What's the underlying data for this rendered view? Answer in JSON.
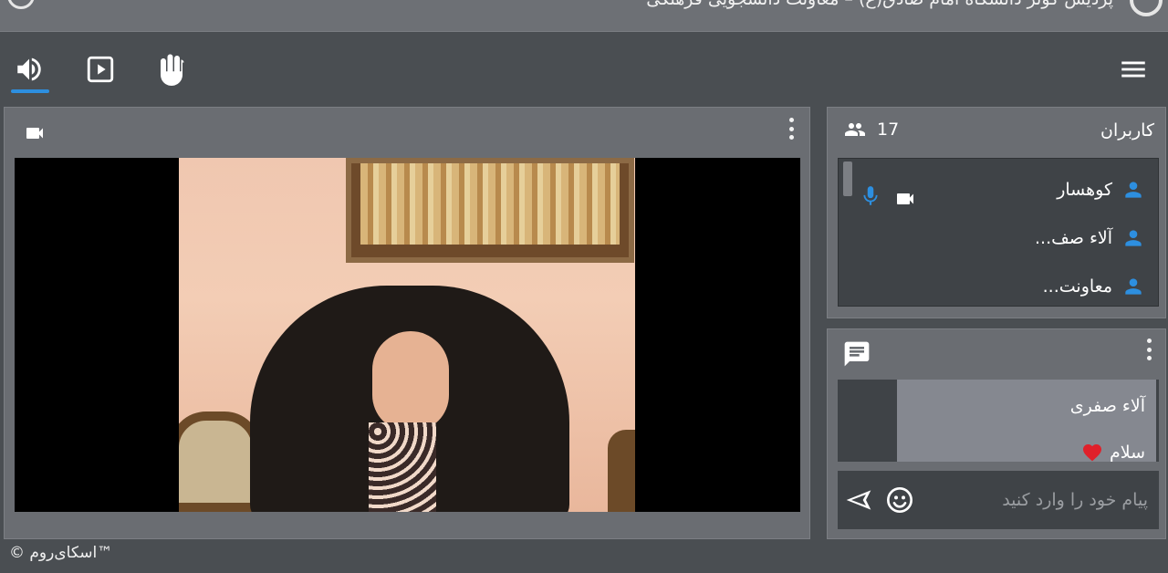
{
  "window": {
    "title": "پرديس  کوثر  دانشگاه  امام  صادق(ع)  –  معاونت  دانشجويی  فرهنگی"
  },
  "toolbar": {
    "audio_icon": "speaker-icon",
    "media_icon": "play-square-icon",
    "hand_icon": "raise-hand-icon",
    "menu_icon": "hamburger-menu-icon",
    "accent_color": "#2d8fe0"
  },
  "video_panel": {
    "camera_icon": "video-camera-icon",
    "options_icon": "more-vertical-icon"
  },
  "users_panel": {
    "title": "کاربران",
    "count": "17",
    "users": [
      {
        "name": "کوهسار",
        "mic": true,
        "camera": true
      },
      {
        "name": "آلاء صف...",
        "mic": false,
        "camera": false
      },
      {
        "name": "معاونت...",
        "mic": false,
        "camera": false
      }
    ],
    "status_color": "#2d8fe0"
  },
  "chat_panel": {
    "chat_icon": "chat-bubble-icon",
    "messages": [
      {
        "sender": "آلاء صفری",
        "text": "سلام",
        "emoji": "heart-emoji"
      }
    ],
    "input_placeholder": "پیام خود را وارد کنید"
  },
  "footer": {
    "brand": "™اسکای‌روم ©"
  }
}
